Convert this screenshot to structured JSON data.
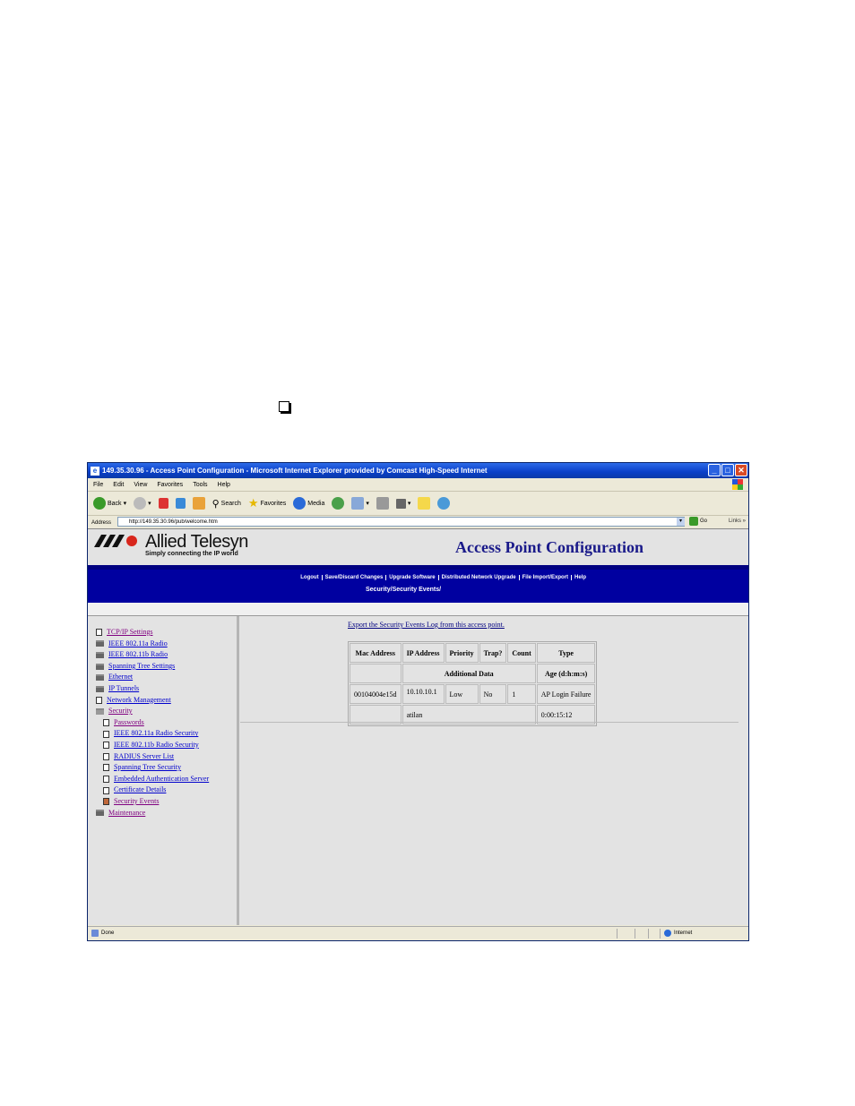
{
  "window": {
    "title": "149.35.30.96 - Access Point Configuration - Microsoft Internet Explorer provided by Comcast High-Speed Internet"
  },
  "menu": [
    "File",
    "Edit",
    "View",
    "Favorites",
    "Tools",
    "Help"
  ],
  "toolbar": {
    "back": "Back",
    "search": "Search",
    "favorites": "Favorites",
    "media": "Media"
  },
  "address": {
    "label": "Address",
    "url": "http://149.35.30.96/pub/welcome.htm",
    "go": "Go",
    "links": "Links"
  },
  "header": {
    "logo_text": "Allied Telesyn",
    "tagline": "Simply connecting the IP world",
    "title": "Access Point Configuration"
  },
  "nav": {
    "links": [
      "Logout",
      "Save/Discard Changes",
      "Upgrade Software",
      "Distributed Network Upgrade",
      "File Import/Export",
      "Help"
    ],
    "breadcrumb": "Security/Security Events/"
  },
  "sidebar": {
    "items": [
      {
        "label": "TCP/IP Settings",
        "icon": "doc-icon",
        "level": 0,
        "visited": true
      },
      {
        "label": "IEEE 802.11a Radio",
        "icon": "folder-icon",
        "level": 0
      },
      {
        "label": "IEEE 802.11b Radio",
        "icon": "folder-icon",
        "level": 0
      },
      {
        "label": "Spanning Tree Settings",
        "icon": "folder-icon",
        "level": 0
      },
      {
        "label": "Ethernet",
        "icon": "folder-icon",
        "level": 0
      },
      {
        "label": "IP Tunnels",
        "icon": "folder-icon",
        "level": 0
      },
      {
        "label": "Network Management",
        "icon": "doc-icon",
        "level": 0
      },
      {
        "label": "Security",
        "icon": "open-folder-icon",
        "level": 0,
        "visited": true
      },
      {
        "label": "Passwords",
        "icon": "doc-icon",
        "level": 1,
        "visited": true
      },
      {
        "label": "IEEE 802.11a Radio Security",
        "icon": "doc-icon",
        "level": 1
      },
      {
        "label": "IEEE 802.11b Radio Security",
        "icon": "doc-icon",
        "level": 1
      },
      {
        "label": "RADIUS Server List",
        "icon": "doc-icon",
        "level": 1
      },
      {
        "label": "Spanning Tree Security",
        "icon": "doc-icon",
        "level": 1
      },
      {
        "label": "Embedded Authentication Server",
        "icon": "doc-icon",
        "level": 1
      },
      {
        "label": "Certificate Details",
        "icon": "doc-icon",
        "level": 1
      },
      {
        "label": "Security Events",
        "icon": "doc-icon-active",
        "level": 1,
        "visited": true
      },
      {
        "label": "Maintenance",
        "icon": "folder-icon",
        "level": 0,
        "visited": true
      }
    ]
  },
  "content": {
    "export_link": "Export the Security Events Log from this access point.",
    "table": {
      "headers": [
        "Mac Address",
        "IP Address",
        "Priority",
        "Trap?",
        "Count",
        "Type"
      ],
      "subheaders": {
        "additional": "Additional Data",
        "age": "Age (d:h:m:s)"
      },
      "rows": [
        {
          "mac": "00104004e15d",
          "ip": "10.10.10.1",
          "priority": "Low",
          "trap": "No",
          "count": "1",
          "type": "AP Login Failure",
          "additional": "atilan",
          "age": "0:00:15:12"
        }
      ]
    }
  },
  "status": {
    "left": "Done",
    "zone": "Internet"
  }
}
